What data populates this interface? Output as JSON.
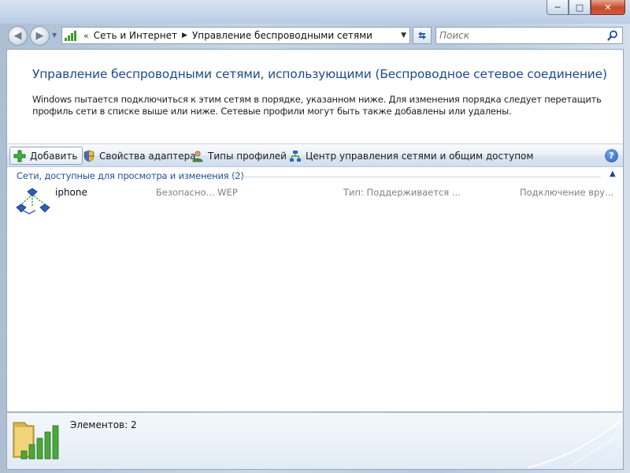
{
  "window": {
    "controls": {
      "minimize": "─",
      "maximize": "□",
      "close": "✕"
    }
  },
  "nav": {
    "back": "◀",
    "forward": "▶",
    "dropdown": "▼"
  },
  "address": {
    "prefix": "«",
    "segments": [
      "Сеть и Интернет",
      "Управление беспроводными сетями"
    ],
    "separator": "▶"
  },
  "search": {
    "placeholder": "Поиск"
  },
  "header": {
    "title": "Управление беспроводными сетями, использующими (Беспроводное сетевое соединение)",
    "description": "Windows пытается подключиться к этим сетям в порядке, указанном ниже. Для изменения порядка следует перетащить профиль сети в списке выше или ниже. Сетевые профили могут быть также добавлены или удалены."
  },
  "toolbar": {
    "add_label": "Добавить",
    "adapter_label": "Свойства адаптера",
    "profiles_label": "Типы профилей",
    "center_label": "Центр управления сетями и общим доступом",
    "help": "?"
  },
  "group": {
    "header": "Сети, доступные для просмотра и изменения (2)",
    "collapse": "▲"
  },
  "networks": [
    {
      "name": "iphone",
      "security": "Безопасно... WEP",
      "type": "Тип:  Поддерживается ...",
      "connection": "Подключение вру..."
    }
  ],
  "status": {
    "items_text": "Элементов: 2"
  },
  "colors": {
    "title": "#1f4a8a",
    "link": "#2050a0",
    "signal_green": "#3d9c2f"
  }
}
